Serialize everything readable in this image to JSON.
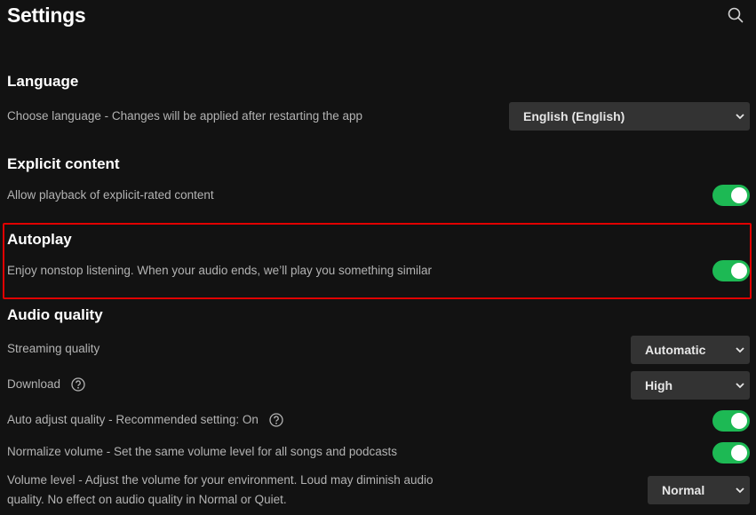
{
  "header": {
    "title": "Settings",
    "search_icon": "search-icon"
  },
  "sections": {
    "language": {
      "title": "Language",
      "choose_label": "Choose language - Changes will be applied after restarting the app",
      "choose_value": "English (English)"
    },
    "explicit": {
      "title": "Explicit content",
      "allow_label": "Allow playback of explicit-rated content",
      "allow_on": true
    },
    "autoplay": {
      "title": "Autoplay",
      "label": "Enjoy nonstop listening. When your audio ends, we’ll play you something similar",
      "on": true,
      "highlight_color": "#e00000"
    },
    "audio_quality": {
      "title": "Audio quality",
      "streaming_label": "Streaming quality",
      "streaming_value": "Automatic",
      "download_label": "Download",
      "download_value": "High",
      "auto_adjust_label": "Auto adjust quality - Recommended setting: On",
      "auto_adjust_on": true,
      "normalize_label": "Normalize volume - Set the same volume level for all songs and podcasts",
      "normalize_on": true,
      "volume_label_line1": "Volume level - Adjust the volume for your environment. Loud may diminish audio",
      "volume_label_line2": "quality. No effect on audio quality in Normal or Quiet.",
      "volume_value": "Normal"
    }
  },
  "colors": {
    "background": "#121212",
    "accent": "#1db954",
    "control_bg": "#333333",
    "muted_text": "#b3b3b3"
  }
}
